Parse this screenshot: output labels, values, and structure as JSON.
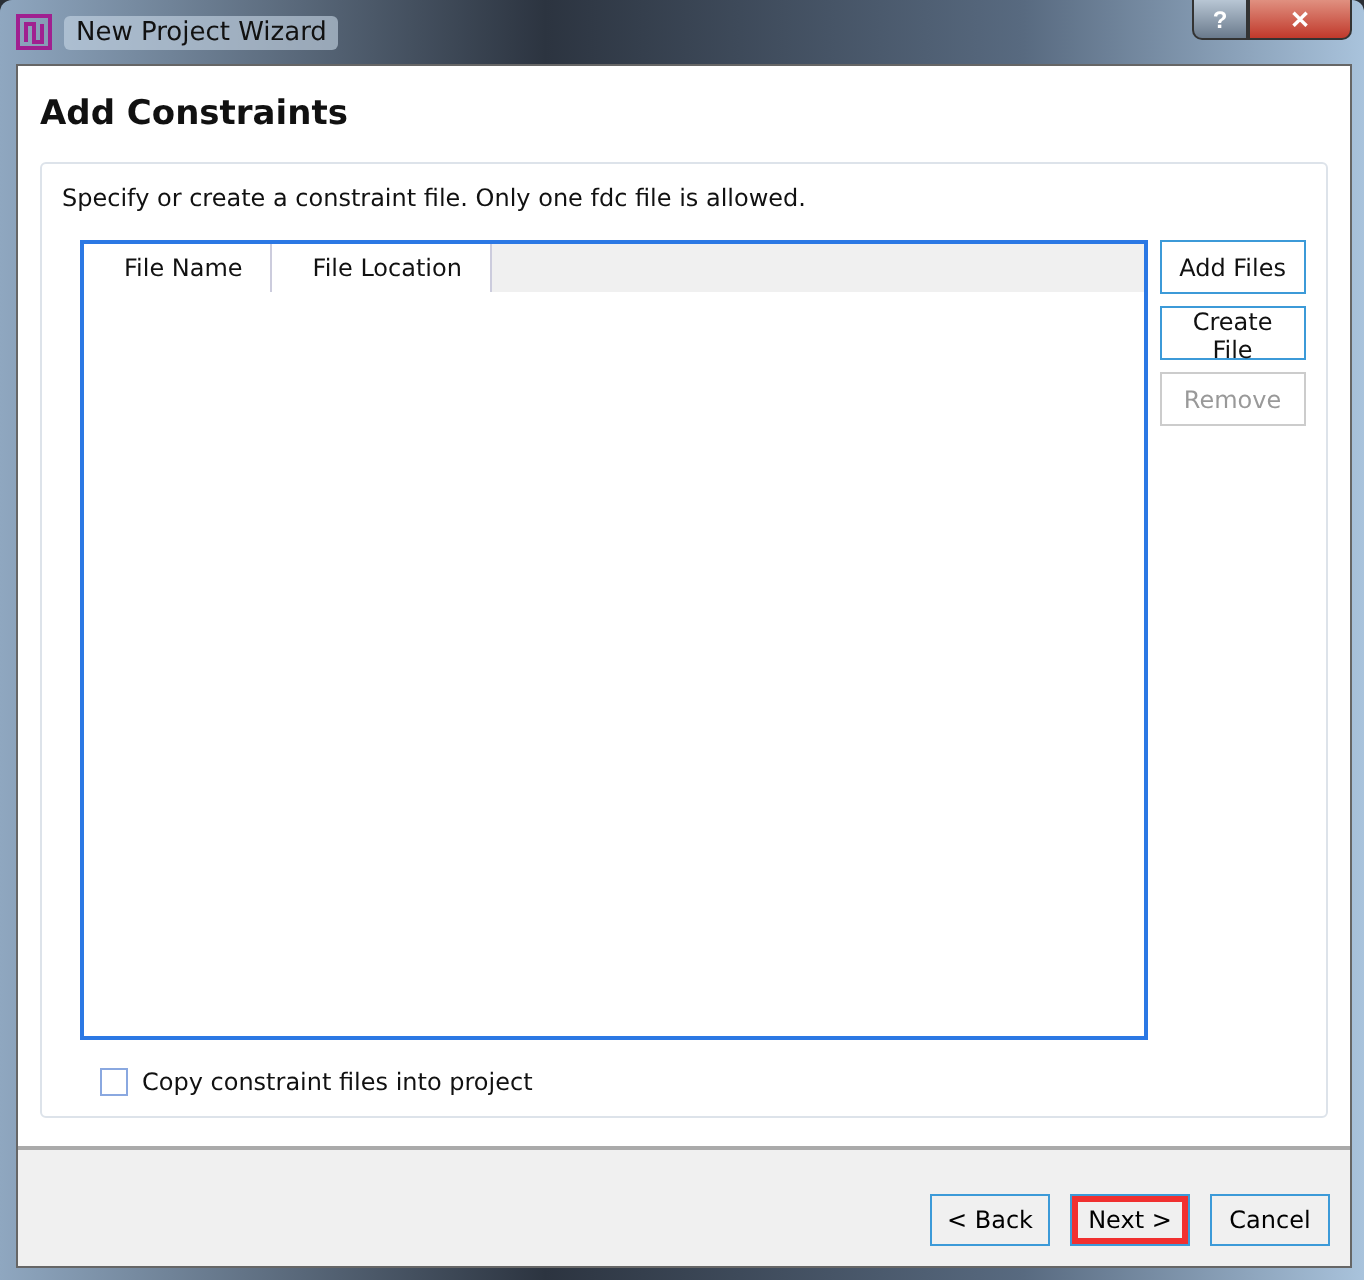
{
  "window": {
    "title": "New Project Wizard",
    "title_buttons": [
      "?",
      "✕"
    ]
  },
  "page_title": "Add Constraints",
  "instruction": "Specify or create a constraint file. Only one fdc file is allowed.",
  "table": {
    "columns": [
      "File Name",
      "File Location"
    ]
  },
  "side_buttons": [
    {
      "label": "Add Files",
      "disabled": false
    },
    {
      "label": "Create File",
      "disabled": false
    },
    {
      "label": "Remove",
      "disabled": true
    }
  ],
  "copy_checkbox": {
    "label": "Copy constraint files into project",
    "checked": false
  },
  "footer_buttons": [
    {
      "label": "< Back",
      "highlighted": false
    },
    {
      "label": "Next >",
      "highlighted": true
    },
    {
      "label": "Cancel",
      "highlighted": false
    }
  ]
}
